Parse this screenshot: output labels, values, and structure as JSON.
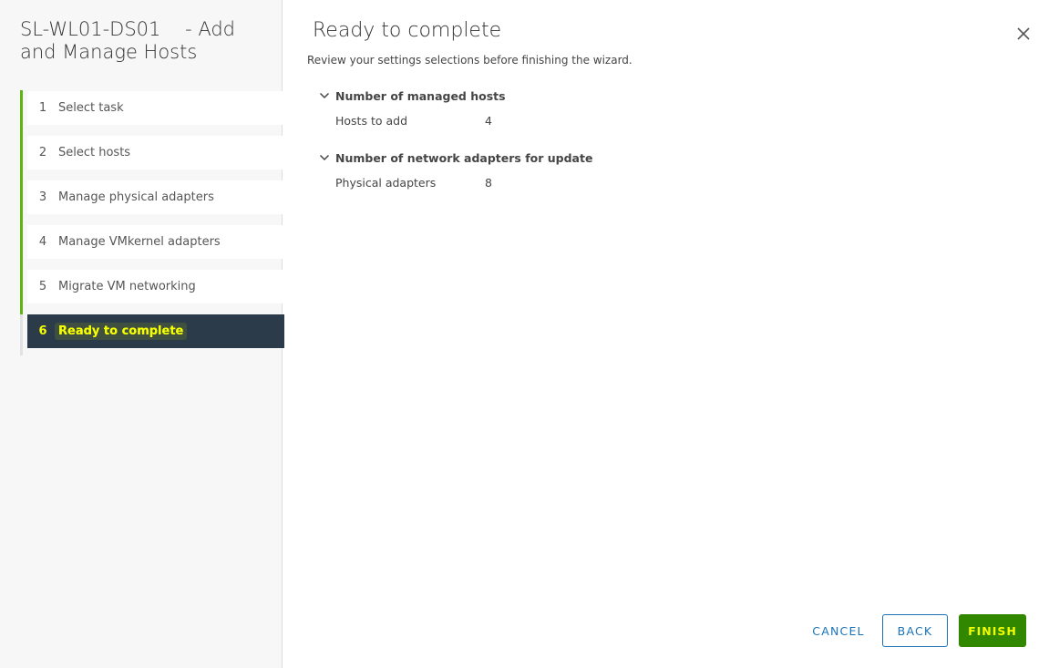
{
  "sidebar": {
    "title": "SL-WL01-DS01    - Add and Manage Hosts",
    "steps": [
      {
        "num": "1",
        "label": "Select task"
      },
      {
        "num": "2",
        "label": "Select hosts"
      },
      {
        "num": "3",
        "label": "Manage physical adapters"
      },
      {
        "num": "4",
        "label": "Manage VMkernel adapters"
      },
      {
        "num": "5",
        "label": "Migrate VM networking"
      },
      {
        "num": "6",
        "label": "Ready to complete"
      }
    ],
    "active_step": 6
  },
  "main": {
    "title": "Ready to complete",
    "subtitle": "Review your settings selections before finishing the wizard.",
    "sections": [
      {
        "header": "Number of managed hosts",
        "rows": [
          {
            "key": "Hosts to add",
            "value": "4"
          }
        ]
      },
      {
        "header": "Number of network adapters for update",
        "rows": [
          {
            "key": "Physical adapters",
            "value": "8"
          }
        ]
      }
    ]
  },
  "footer": {
    "cancel_label": "CANCEL",
    "back_label": "BACK",
    "finish_label": "FINISH"
  },
  "icons": {
    "close": "close-icon",
    "chevron": "chevron-down-icon"
  },
  "colors": {
    "completed_step_bar": "#60b515",
    "active_step_bg": "#2b3b49",
    "highlight_text": "#f5ff00",
    "finish_button": "#318700",
    "link_blue": "#1a73b8"
  }
}
